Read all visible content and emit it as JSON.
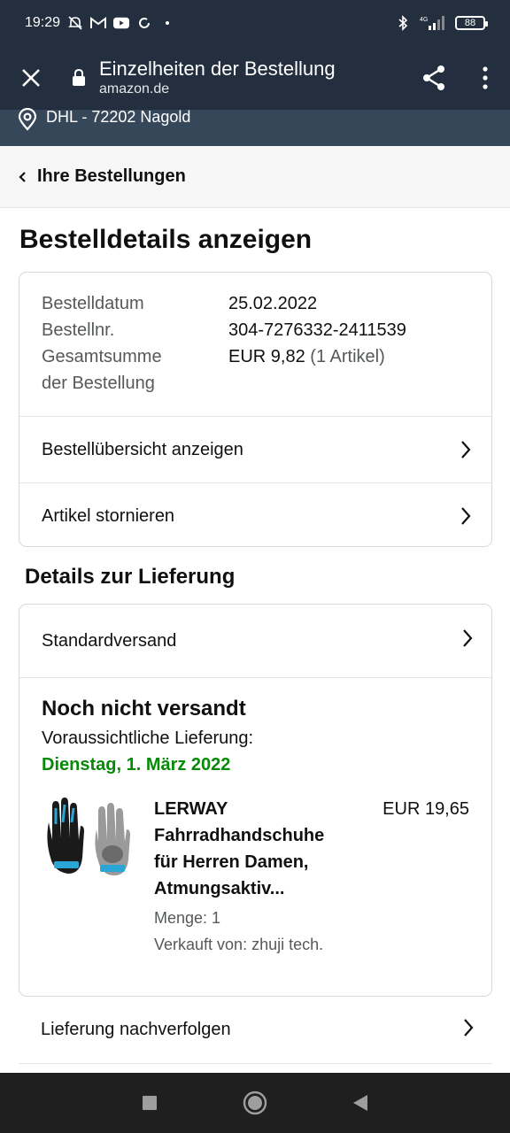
{
  "status_bar": {
    "time": "19:29",
    "battery": "88",
    "network": "4G"
  },
  "tab_header": {
    "title": "Einzelheiten der Bestellung",
    "domain": "amazon.de"
  },
  "location": {
    "text": "DHL - 72202 Nagold"
  },
  "breadcrumb": {
    "label": "Ihre Bestellungen"
  },
  "page": {
    "title": "Bestelldetails anzeigen"
  },
  "summary": {
    "order_date_label": "Bestelldatum",
    "order_date_value": "25.02.2022",
    "order_no_label": "Bestellnr.",
    "order_no_value": "304-7276332-2411539",
    "total_label_line1": "Gesamtsumme",
    "total_label_line2": "der Bestellung",
    "total_value": "EUR 9,82",
    "total_items": "(1 Artikel)",
    "view_overview": "Bestellübersicht anzeigen",
    "cancel_items": "Artikel stornieren"
  },
  "delivery": {
    "section_title": "Details zur Lieferung",
    "shipping_method": "Standardversand",
    "status": "Noch nicht versandt",
    "eta_label": "Voraussichtliche Lieferung:",
    "eta_date": "Dienstag, 1. März 2022",
    "item": {
      "title": "LERWAY Fahrradhandschuhe für Herren Damen, Atmungsaktiv...",
      "quantity": "Menge: 1",
      "seller": "Verkauft von: zhuji tech.",
      "price": "EUR 19,65"
    },
    "track": "Lieferung nachverfolgen"
  },
  "colors": {
    "header_bg": "#232f3e",
    "location_bg": "#37475a",
    "eta_green": "#078a07"
  },
  "icons": [
    "close-icon",
    "lock-icon",
    "share-icon",
    "more-vert-icon",
    "location-pin-icon",
    "chevron-left-icon",
    "chevron-right-icon",
    "nav-recents-icon",
    "nav-home-icon",
    "nav-back-icon"
  ]
}
